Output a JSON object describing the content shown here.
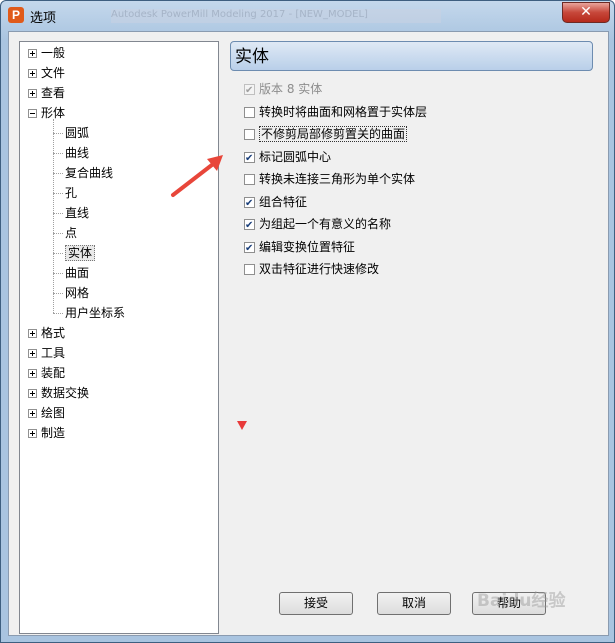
{
  "window": {
    "title": "选项",
    "app_icon": "P",
    "background_title": "Autodesk PowerMill Modeling 2017 - [NEW_MODEL]",
    "close_glyph": "✕"
  },
  "tree": {
    "top": [
      {
        "label": "一般",
        "expanded": false
      },
      {
        "label": "文件",
        "expanded": false
      },
      {
        "label": "查看",
        "expanded": false
      },
      {
        "label": "形体",
        "expanded": true
      }
    ],
    "children": [
      {
        "label": "圆弧"
      },
      {
        "label": "曲线"
      },
      {
        "label": "复合曲线"
      },
      {
        "label": "孔"
      },
      {
        "label": "直线"
      },
      {
        "label": "点"
      },
      {
        "label": "实体",
        "selected": true
      },
      {
        "label": "曲面"
      },
      {
        "label": "网格"
      },
      {
        "label": "用户坐标系"
      }
    ],
    "bottom": [
      {
        "label": "格式"
      },
      {
        "label": "工具"
      },
      {
        "label": "装配"
      },
      {
        "label": "数据交换"
      },
      {
        "label": "绘图"
      },
      {
        "label": "制造"
      }
    ]
  },
  "panel": {
    "title": "实体",
    "options": [
      {
        "label": "版本 8 实体",
        "checked": true,
        "disabled": true
      },
      {
        "label": "转换时将曲面和网格置于实体层",
        "checked": false
      },
      {
        "label": "不修剪局部修剪置关的曲面",
        "checked": false,
        "focused": true
      },
      {
        "label": "标记圆弧中心",
        "checked": true
      },
      {
        "label": "转换未连接三角形为单个实体",
        "checked": false
      },
      {
        "label": "组合特征",
        "checked": true
      },
      {
        "label": "为组起一个有意义的名称",
        "checked": true
      },
      {
        "label": "编辑变换位置特征",
        "checked": true
      },
      {
        "label": "双击特征进行快速修改",
        "checked": false
      }
    ]
  },
  "buttons": {
    "accept": "接受",
    "cancel": "取消",
    "help": "帮助"
  },
  "annotations": {
    "arrow_color": "#e8463a",
    "marker_color": "#e83a3a"
  },
  "watermark": "Baidu经验"
}
